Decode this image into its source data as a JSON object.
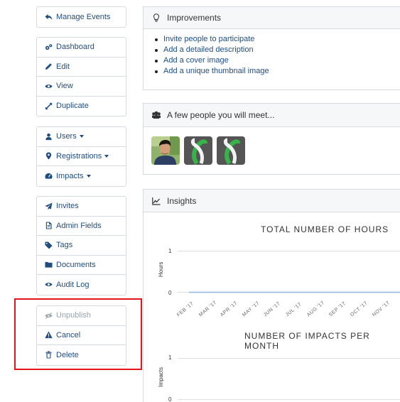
{
  "sidebar": {
    "manage": {
      "label": "Manage Events"
    },
    "group1": [
      {
        "label": "Dashboard",
        "icon": "gears-icon"
      },
      {
        "label": "Edit",
        "icon": "pencil-icon"
      },
      {
        "label": "View",
        "icon": "eye-icon"
      },
      {
        "label": "Duplicate",
        "icon": "expand-arrows-icon"
      }
    ],
    "group2": [
      {
        "label": "Users",
        "icon": "user-icon"
      },
      {
        "label": "Registrations",
        "icon": "map-marker-icon"
      },
      {
        "label": "Impacts",
        "icon": "tachometer-icon"
      }
    ],
    "group3": [
      {
        "label": "Invites",
        "icon": "paper-plane-icon"
      },
      {
        "label": "Admin Fields",
        "icon": "file-text-icon"
      },
      {
        "label": "Tags",
        "icon": "tag-icon"
      },
      {
        "label": "Documents",
        "icon": "folder-icon"
      },
      {
        "label": "Audit Log",
        "icon": "eye-icon"
      }
    ],
    "group4": [
      {
        "label": "Unpublish",
        "icon": "eye-slash-icon"
      },
      {
        "label": "Cancel",
        "icon": "warning-icon"
      },
      {
        "label": "Delete",
        "icon": "trash-icon"
      }
    ]
  },
  "improvements": {
    "title": "Improvements",
    "items": [
      "Invite people to participate",
      "Add a detailed description",
      "Add a cover image",
      "Add a unique thumbnail image"
    ]
  },
  "people": {
    "title": "A few people you will meet..."
  },
  "insights": {
    "title": "Insights"
  },
  "chart_data": [
    {
      "type": "line",
      "title": "TOTAL NUMBER OF HOURS",
      "ylabel": "Hours",
      "xlabel": "",
      "categories": [
        "FEB '17",
        "MAR '17",
        "APR '17",
        "MAY '17",
        "JUN '17",
        "JUL '17",
        "AUG '17",
        "SEP '17",
        "OCT '17",
        "NOV '17"
      ],
      "yticks": [
        "1",
        "0"
      ],
      "ylim": [
        0,
        1
      ],
      "series": [
        {
          "values": [
            0,
            0,
            0,
            0,
            0,
            0,
            0,
            0,
            0,
            0
          ]
        }
      ]
    },
    {
      "type": "line",
      "title": "NUMBER OF IMPACTS PER MONTH",
      "ylabel": "Impacts",
      "xlabel": "",
      "categories": [],
      "yticks": [
        "1",
        "0"
      ],
      "ylim": [
        0,
        1
      ],
      "series": []
    }
  ],
  "colors": {
    "link": "#1f4d80",
    "highlight": "#e4161b",
    "line": "#8fb4dd"
  }
}
